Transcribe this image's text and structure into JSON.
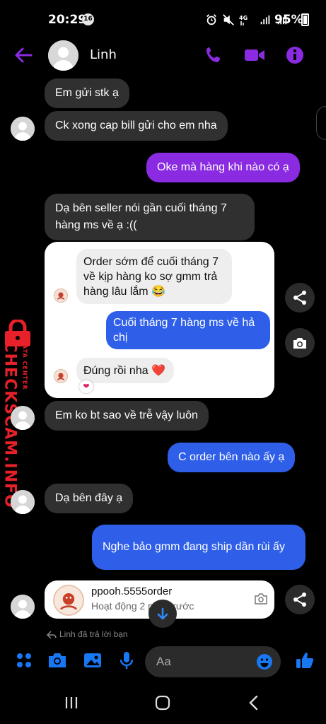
{
  "status_bar": {
    "time": "20:29",
    "notification_badge": "16",
    "network": "4G",
    "battery": "95%"
  },
  "header": {
    "contact_name": "Linh",
    "icons": [
      "back-arrow-icon",
      "phone-icon",
      "video-camera-icon",
      "info-icon"
    ]
  },
  "messages": [
    {
      "side": "in",
      "text": "Em gửi stk ạ"
    },
    {
      "side": "in",
      "text": "Ck xong cap bill gửi cho em nha"
    },
    {
      "side": "out",
      "text": "Oke mà hàng khi nào có ạ"
    },
    {
      "side": "in",
      "text": "Dạ bên seller nói gần cuối tháng 7 hàng ms về ạ :(("
    },
    {
      "side": "in",
      "text": "Em ko bt sao về trễ vậy luôn"
    },
    {
      "side": "out",
      "text": "C order bên nào ấy ạ"
    },
    {
      "side": "in",
      "text": "Dạ bên đây ạ"
    },
    {
      "side": "out",
      "text": "Nghe bảo gmm đang ship dần rùi ấy"
    }
  ],
  "shared_screenshot": {
    "messages": [
      {
        "side": "in",
        "text": "Order sớm để cuối tháng 7 về kịp hàng ko sợ gmm trả hàng lâu lắm 😂"
      },
      {
        "side": "out",
        "text": "Cuối tháng 7 hàng ms về hả chị"
      },
      {
        "side": "in",
        "text": "Đúng rồi nha ❤️"
      }
    ],
    "reaction": "❤"
  },
  "watermark": {
    "brand": "CHECKSCAM.INFO",
    "tagline": "DATA CENTER"
  },
  "link_card": {
    "name": "ppooh.5555order",
    "status": "Hoạt động 2 phút trước"
  },
  "replied_text": "Linh đã trả lời bạn",
  "composer": {
    "placeholder": "Aa"
  },
  "colors": {
    "outgoing": "#8a2be2",
    "shared_outgoing": "#2f5fe8",
    "incoming": "#303030",
    "accent": "#8a2be2",
    "composer_blue": "#1877f2",
    "watermark": "#e8202a"
  }
}
